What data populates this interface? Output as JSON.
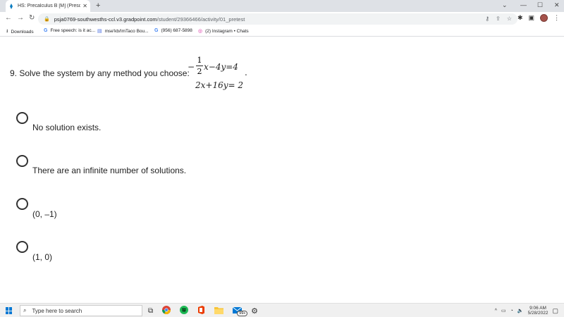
{
  "browser": {
    "tab_title": "HS: Precalculus B [M] (Prescriptio",
    "tab_close": "✕",
    "new_tab": "+",
    "url_host": "psja0769-southwesths-ccl.v3.gradpoint.com",
    "url_path": "/student/29366466/activity/01_pretest"
  },
  "bookmarks": [
    {
      "label": "Downloads",
      "icon": "download-icon"
    },
    {
      "label": "Free speech: is it ac...",
      "icon": "google-icon"
    },
    {
      "label": "mse'kb/ImTaco Bou...",
      "icon": "doc-icon"
    },
    {
      "label": "(956) 687-5898",
      "icon": "google-icon"
    },
    {
      "label": "(2) Instagram • Chats",
      "icon": "instagram-icon"
    }
  ],
  "question": {
    "number_text": "9. Solve the system by any method you choose:",
    "eq1_minus": "−",
    "frac_num": "1",
    "frac_den": "2",
    "eq1_rest": "x−4y=4",
    "eq2": "2x+16y= 2",
    "trailing_dot": "."
  },
  "options": [
    {
      "label": "No solution exists."
    },
    {
      "label": "There are an infinite number of solutions."
    },
    {
      "label": "(0, –1)"
    },
    {
      "label": "(1, 0)"
    }
  ],
  "taskbar": {
    "search_placeholder": "Type here to search",
    "badge": "99+",
    "time": "9:06 AM",
    "date": "5/28/2022"
  }
}
